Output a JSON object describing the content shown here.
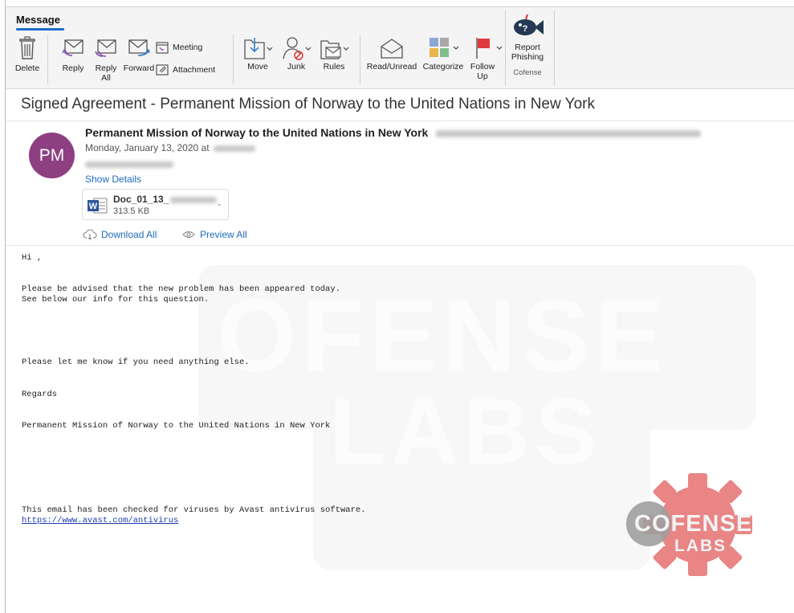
{
  "ribbon": {
    "tab": "Message",
    "buttons": {
      "delete": "Delete",
      "reply": "Reply",
      "reply_all": "Reply All",
      "forward": "Forward",
      "meeting": "Meeting",
      "attachment": "Attachment",
      "move": "Move",
      "junk": "Junk",
      "rules": "Rules",
      "read_unread": "Read/Unread",
      "categorize": "Categorize",
      "follow_up": "Follow Up",
      "report_phishing": "Report Phishing"
    },
    "group_label": "Cofense"
  },
  "email": {
    "subject": "Signed Agreement - Permanent Mission of Norway to the United Nations in New York",
    "avatar_initials": "PM",
    "sender_name": "Permanent Mission of Norway to the United Nations in New York",
    "date_prefix": "Monday, January 13, 2020 at",
    "show_details": "Show Details",
    "attachment": {
      "name": "Doc_01_13_",
      "size": "313.5 KB"
    },
    "download_all": "Download All",
    "preview_all": "Preview All",
    "body": {
      "greeting": "Hi ,",
      "line1": "Please be advised that the new problem has been appeared today.",
      "line2": "See below our info for this question.",
      "line3": "Please let me know if you need anything else.",
      "regards": "Regards",
      "signature": "Permanent Mission of Norway to the United Nations in New York",
      "avast_note": "This email has been checked for viruses by Avast antivirus software.",
      "avast_link": "https://www.avast.com/antivirus"
    }
  },
  "watermark": {
    "line1": "OFENSE",
    "line2": "LABS"
  },
  "logo": {
    "line1": "COFENSE",
    "line2": "LABS"
  },
  "colors": {
    "avatar": "#8e3f82",
    "link": "#1c6bbd",
    "accent": "#1f6fc5",
    "logo_gear": "#e77574"
  }
}
